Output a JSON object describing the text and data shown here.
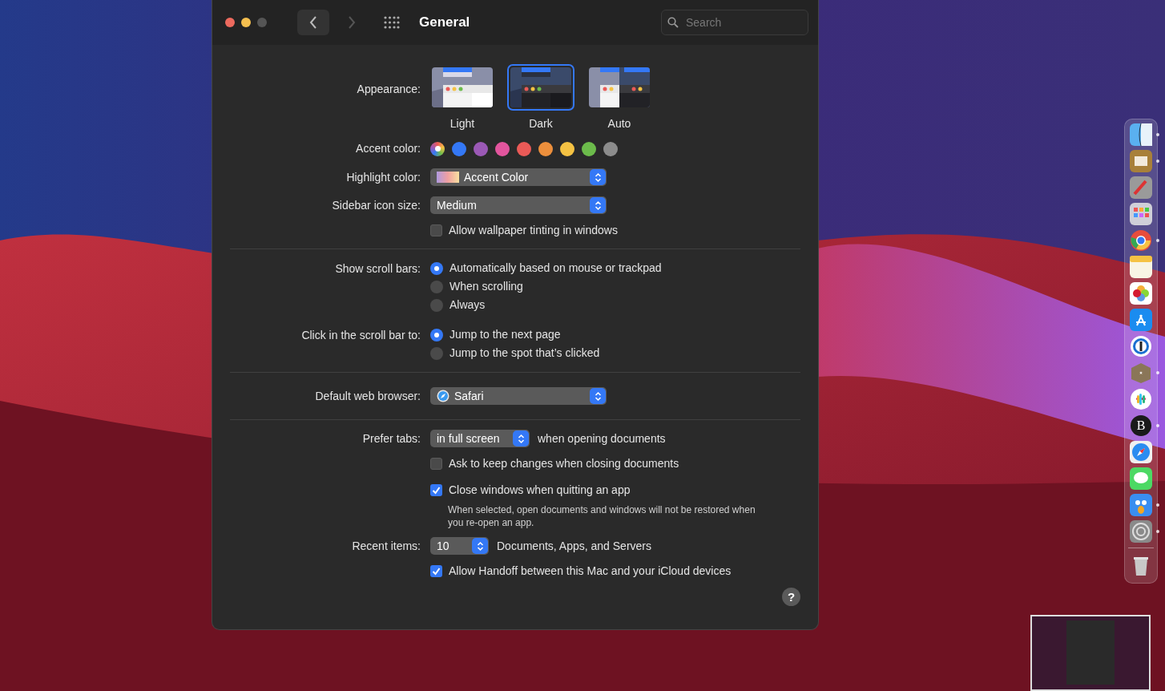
{
  "window": {
    "title": "General",
    "search": {
      "placeholder": "Search"
    }
  },
  "appearance": {
    "label": "Appearance:",
    "options": [
      {
        "label": "Light",
        "kind": "light",
        "selected": false
      },
      {
        "label": "Dark",
        "kind": "dark",
        "selected": true
      },
      {
        "label": "Auto",
        "kind": "auto",
        "selected": false
      }
    ]
  },
  "accent": {
    "label": "Accent color:",
    "colors": [
      {
        "kind": "multi"
      },
      {
        "color": "#3478f6"
      },
      {
        "color": "#9b59b6"
      },
      {
        "color": "#e3559e"
      },
      {
        "color": "#ea5a57"
      },
      {
        "color": "#ec8f3c"
      },
      {
        "color": "#f5c243"
      },
      {
        "color": "#6cbb4b"
      },
      {
        "color": "#8c8c8c"
      }
    ]
  },
  "highlight": {
    "label": "Highlight color:",
    "value": "Accent Color"
  },
  "sidebar_icon_size": {
    "label": "Sidebar icon size:",
    "value": "Medium"
  },
  "wallpaper_tinting": {
    "label": "Allow wallpaper tinting in windows",
    "checked": false
  },
  "scroll_bars": {
    "label": "Show scroll bars:",
    "options": [
      {
        "label": "Automatically based on mouse or trackpad",
        "selected": true
      },
      {
        "label": "When scrolling",
        "selected": false
      },
      {
        "label": "Always",
        "selected": false
      }
    ]
  },
  "click_scroll": {
    "label": "Click in the scroll bar to:",
    "options": [
      {
        "label": "Jump to the next page",
        "selected": true
      },
      {
        "label": "Jump to the spot that’s clicked",
        "selected": false
      }
    ]
  },
  "browser": {
    "label": "Default web browser:",
    "value": "Safari"
  },
  "prefer_tabs": {
    "label": "Prefer tabs:",
    "value": "in full screen",
    "suffix": "when opening documents"
  },
  "ask_keep": {
    "label": "Ask to keep changes when closing documents",
    "checked": false
  },
  "close_windows": {
    "label": "Close windows when quitting an app",
    "checked": true,
    "note": "When selected, open documents and windows will not be restored when you re-open an app."
  },
  "recent_items": {
    "label": "Recent items:",
    "value": "10",
    "suffix": "Documents, Apps, and Servers"
  },
  "handoff": {
    "label": "Allow Handoff between this Mac and your iCloud devices",
    "checked": true
  },
  "help": {
    "label": "?"
  },
  "dock": [
    {
      "kind": "finder",
      "running": true
    },
    {
      "kind": "box",
      "running": true
    },
    {
      "kind": "script",
      "running": false
    },
    {
      "kind": "grid",
      "running": false
    },
    {
      "kind": "chrome",
      "running": true
    },
    {
      "kind": "notes",
      "running": false
    },
    {
      "kind": "photos",
      "running": false
    },
    {
      "kind": "store",
      "running": false
    },
    {
      "kind": "ring",
      "running": false
    },
    {
      "kind": "cube",
      "running": true
    },
    {
      "kind": "slack",
      "running": false
    },
    {
      "kind": "letter",
      "label": "B",
      "running": true
    },
    {
      "kind": "safari",
      "running": false
    },
    {
      "kind": "messages",
      "running": false
    },
    {
      "kind": "bird",
      "running": true
    },
    {
      "kind": "gear",
      "running": true
    },
    {
      "kind": "trash",
      "running": false
    }
  ]
}
